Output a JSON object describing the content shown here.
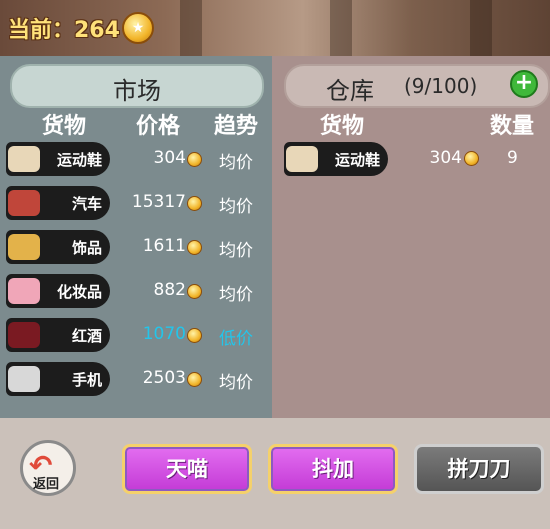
{
  "header": {
    "coins_label": "当前：264",
    "coin_icon": "coin-icon"
  },
  "market": {
    "title": "市场",
    "col_goods": "货物",
    "col_price": "价格",
    "col_trend": "趋势",
    "items": [
      {
        "name": "运动鞋",
        "price": "304",
        "trend": "均价",
        "icon": "sneaker-icon",
        "icon_color": "#e8d7b8"
      },
      {
        "name": "汽车",
        "price": "15317",
        "trend": "均价",
        "icon": "car-icon",
        "icon_color": "#c0463a"
      },
      {
        "name": "饰品",
        "price": "1611",
        "trend": "均价",
        "icon": "jewelry-icon",
        "icon_color": "#e3b24a"
      },
      {
        "name": "化妆品",
        "price": "882",
        "trend": "均价",
        "icon": "cosmetics-icon",
        "icon_color": "#f0a6b8"
      },
      {
        "name": "红酒",
        "price": "1070",
        "trend": "低价",
        "icon": "wine-icon",
        "icon_color": "#7a1a22",
        "low": true
      },
      {
        "name": "手机",
        "price": "2503",
        "trend": "均价",
        "icon": "phone-icon",
        "icon_color": "#d8d8d8"
      }
    ]
  },
  "warehouse": {
    "title": "仓库",
    "capacity": "(9/100)",
    "col_goods": "货物",
    "col_qty": "数量",
    "items": [
      {
        "name": "运动鞋",
        "price": "304",
        "qty": "9",
        "icon": "sneaker-icon"
      }
    ]
  },
  "buttons": {
    "back": "返回",
    "tmall": "天喵",
    "douyin": "抖加",
    "pdd": "拼刀刀"
  },
  "colors": {
    "low_trend": "#23c5ea",
    "accent_purple": "#c33ad6"
  }
}
